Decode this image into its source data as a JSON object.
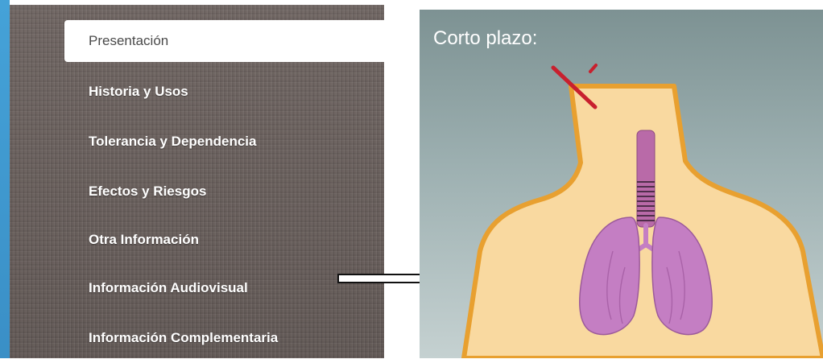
{
  "sidebar": {
    "items": [
      {
        "label": "Presentación",
        "active": true
      },
      {
        "label": "Historia y Usos",
        "active": false
      },
      {
        "label": "Tolerancia y Dependencia",
        "active": false
      },
      {
        "label": "Efectos y Riesgos",
        "active": false
      },
      {
        "label": "Otra Información",
        "active": false
      },
      {
        "label": "Información Audiovisual",
        "active": false
      },
      {
        "label": "Información Complementaria",
        "active": false
      }
    ]
  },
  "illustration": {
    "title": "Corto plazo:",
    "colors": {
      "skin": "#f9d9a0",
      "outline": "#e8a030",
      "lungs": "#c47ec3",
      "trachea": "#b96aa8",
      "accent": "#c8202e"
    }
  },
  "annotation": {
    "arrow": "white-arrow-right"
  },
  "theme": {
    "stripe": "#45a2d8",
    "sidebar_bg": "#6d6461",
    "active_bg": "#ffffff"
  }
}
